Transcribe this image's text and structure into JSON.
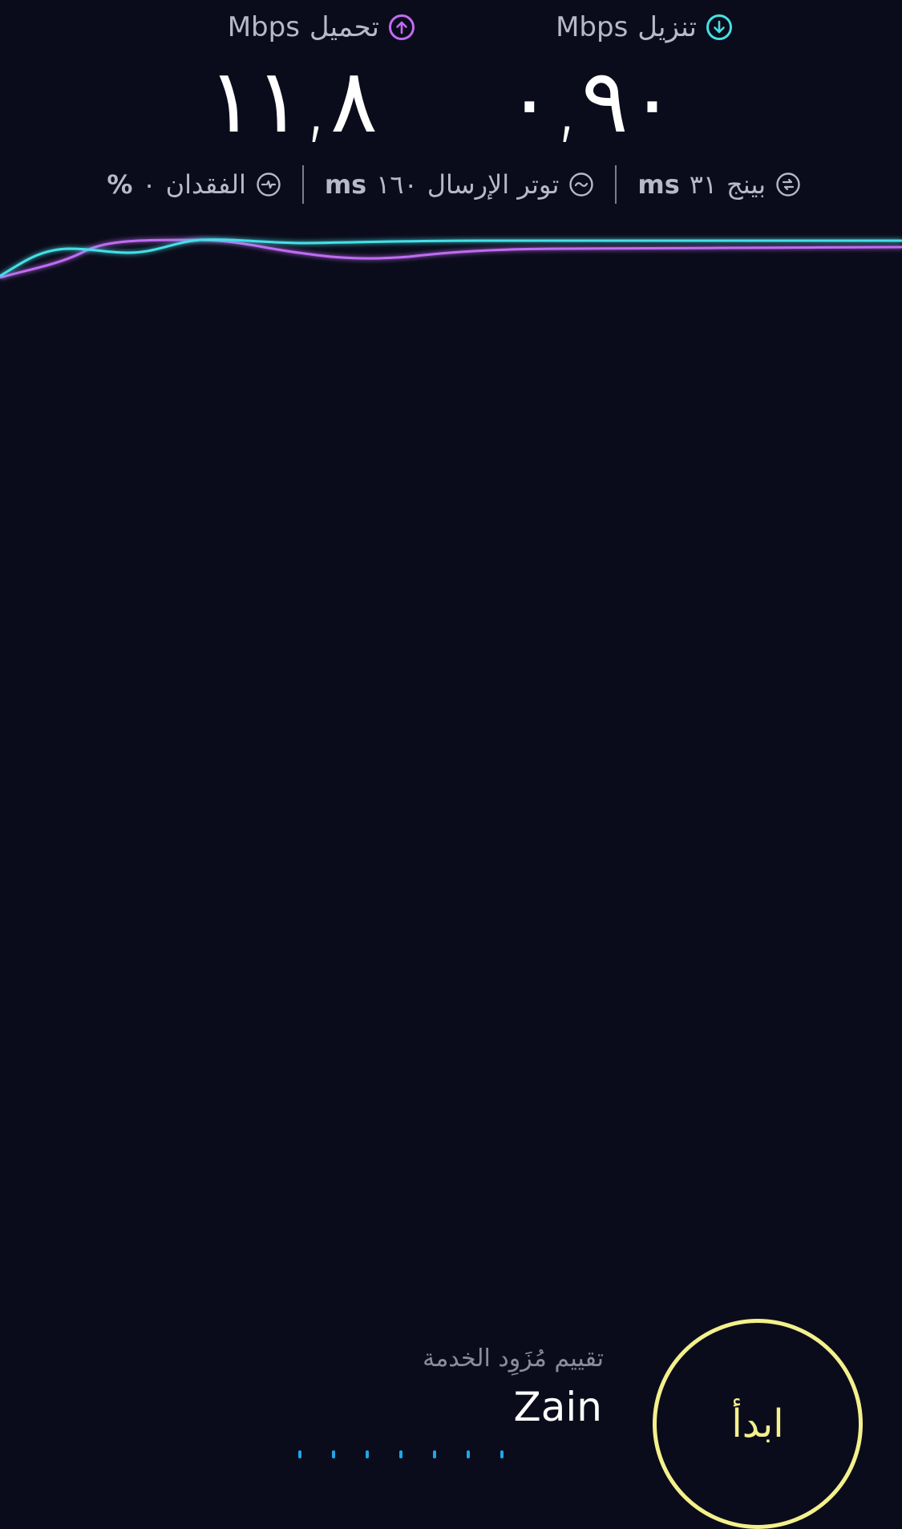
{
  "download": {
    "label": "تنزيل",
    "unit": "Mbps",
    "value": "٠,٩٠",
    "icon": "download-arrow-icon",
    "color": "#45e0e6"
  },
  "upload": {
    "label": "تحميل",
    "unit": "Mbps",
    "value": "١١,٨",
    "icon": "upload-arrow-icon",
    "color": "#c06cf2"
  },
  "stats": {
    "ping": {
      "label": "بينج",
      "value": "٣١",
      "unit": "ms",
      "icon": "ping-icon"
    },
    "jitter": {
      "label": "توتر الإرسال",
      "value": "١٦٠",
      "unit": "ms",
      "icon": "jitter-icon"
    },
    "loss": {
      "label": "الفقدان",
      "value": "٠",
      "unit": "%",
      "icon": "packet-loss-icon"
    }
  },
  "provider": {
    "rate_label": "تقييم مُزَوِد الخدمة",
    "name": "Zain"
  },
  "start_button": {
    "label": "ابدأ",
    "color": "#f4f18c"
  }
}
